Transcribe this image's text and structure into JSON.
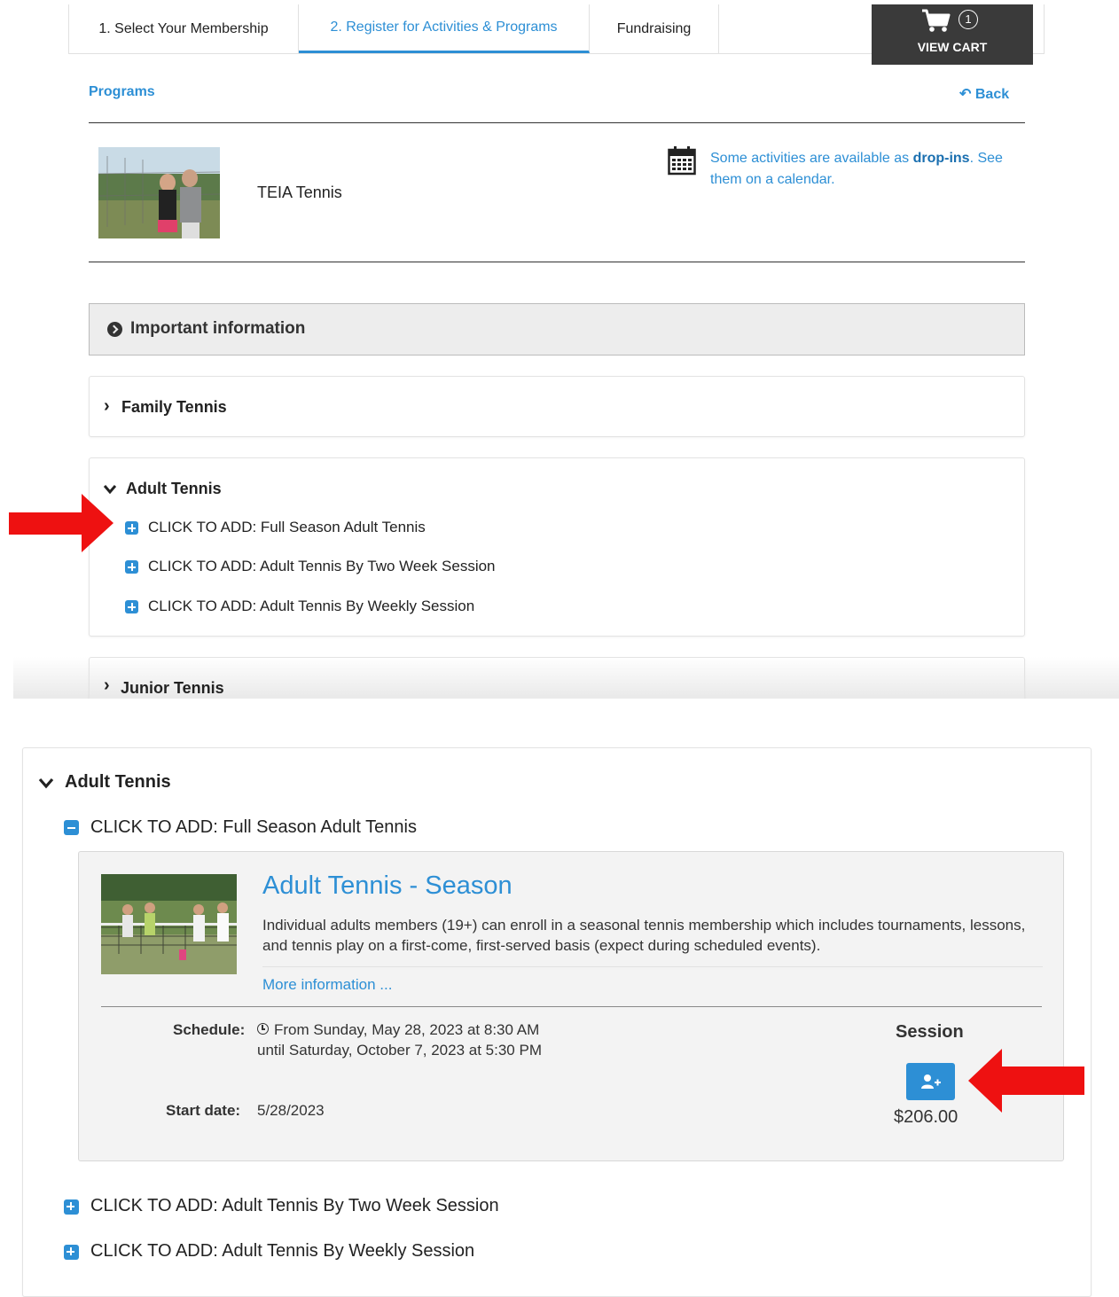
{
  "tabs": [
    {
      "label": "1. Select Your Membership",
      "active": false
    },
    {
      "label": "2. Register for Activities & Programs",
      "active": true
    },
    {
      "label": "Fundraising",
      "active": false
    }
  ],
  "cart": {
    "count": "1",
    "label": "VIEW CART"
  },
  "breadcrumb": {
    "programs": "Programs",
    "back": "Back"
  },
  "program": {
    "name": "TEIA Tennis",
    "dropin_pre": "Some activities are available as ",
    "dropin_bold": "drop-ins",
    "dropin_line1_post": ". See",
    "dropin_line2": "them on a calendar."
  },
  "important": {
    "label": "Important information"
  },
  "categories": {
    "family": "Family Tennis",
    "adult": "Adult Tennis",
    "junior": "Junior Tennis"
  },
  "adult_items": [
    "CLICK TO ADD: Full Season Adult Tennis",
    "CLICK TO ADD: Adult Tennis By Two Week Session",
    "CLICK TO ADD: Adult Tennis By Weekly Session"
  ],
  "detail": {
    "category": "Adult Tennis",
    "expanded_item": "CLICK TO ADD: Full Season Adult Tennis",
    "title": "Adult Tennis - Season",
    "description": "Individual adults members (19+) can enroll in a seasonal tennis membership which includes tournaments, lessons, and tennis play on a first-come, first-served basis (expect during scheduled events).",
    "more_info": "More information ...",
    "schedule_label": "Schedule:",
    "schedule_line1": "From Sunday, May 28, 2023 at 8:30 AM",
    "schedule_line2": "until Saturday, October 7, 2023 at 5:30 PM",
    "start_label": "Start date:",
    "start_value": "5/28/2023",
    "session_label": "Session",
    "price": "$206.00",
    "other_items": [
      "CLICK TO ADD: Adult Tennis By Two Week Session",
      "CLICK TO ADD: Adult Tennis By Weekly Session"
    ]
  },
  "colors": {
    "accent": "#2d8fd5",
    "arrow": "#ee1111",
    "cart_bg": "#3a3a3a"
  }
}
